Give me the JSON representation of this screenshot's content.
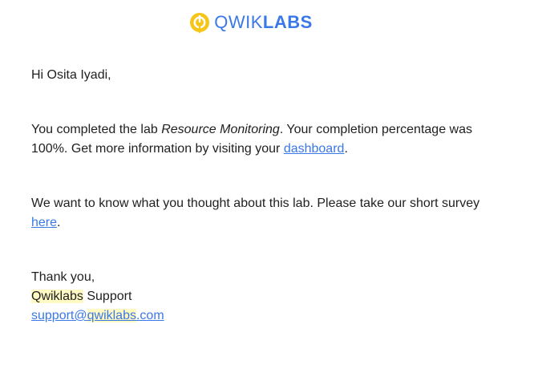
{
  "header": {
    "logo_icon": "qwiklabs-logo-icon",
    "logo_text_light": "QWIK",
    "logo_text_bold": "LABS",
    "brand_colors": {
      "mark_yellow": "#f5c518",
      "text_blue": "#3b78e7"
    }
  },
  "email": {
    "greeting": "Hi Osita Iyadi,",
    "completion": {
      "prefix": "You completed the lab ",
      "lab_name": "Resource Monitoring",
      "middle": ". Your completion percentage was 100%. Get more information by visiting your ",
      "dashboard_link": "dashboard",
      "suffix": "."
    },
    "survey": {
      "prefix": "We want to know what you thought about this lab. Please take our short survey ",
      "link": "here",
      "suffix": "."
    },
    "signoff": {
      "thanks": "Thank you,",
      "brand": "Qwiklabs",
      "team": " Support",
      "email_user": "support@",
      "email_brand": "qwiklabs",
      "email_domain": ".com"
    }
  },
  "colors": {
    "link": "#3b78e7",
    "highlight": "#fff9c4",
    "text": "#212121"
  }
}
